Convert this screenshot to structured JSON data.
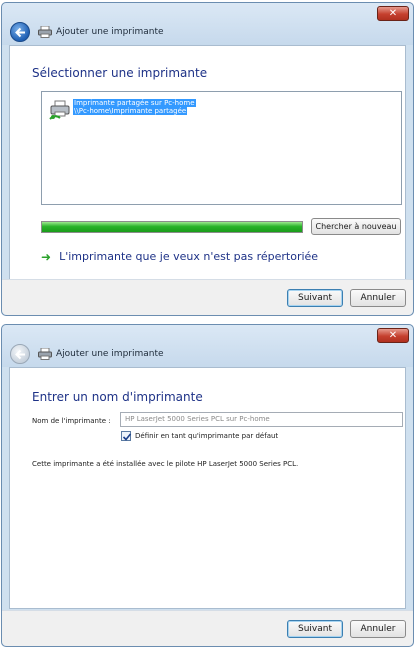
{
  "window_title": "Ajouter une imprimante",
  "close_label": "✕",
  "step1": {
    "heading": "Sélectionner une imprimante",
    "printers": [
      {
        "name": "Imprimante partagée sur Pc-home",
        "path": "\\\\Pc-home\\Imprimante partagée",
        "selected": true
      }
    ],
    "progress": 1.0,
    "search_again_label": "Chercher à nouveau",
    "not_listed_label": "L'imprimante que je veux n'est pas répertoriée",
    "next_label": "Suivant",
    "cancel_label": "Annuler"
  },
  "step2": {
    "heading": "Entrer un nom d'imprimante",
    "name_label": "Nom de l'imprimante :",
    "name_value": "HP LaserJet 5000 Series PCL sur Pc-home",
    "default_label": "Définir en tant qu'imprimante par défaut",
    "default_checked": true,
    "installed_note": "Cette imprimante a été installée avec le pilote HP LaserJet 5000 Series PCL.",
    "next_label": "Suivant",
    "cancel_label": "Annuler"
  },
  "colors": {
    "accent_text": "#1e3287",
    "selection": "#3399ff",
    "progress": "#29b32a"
  }
}
